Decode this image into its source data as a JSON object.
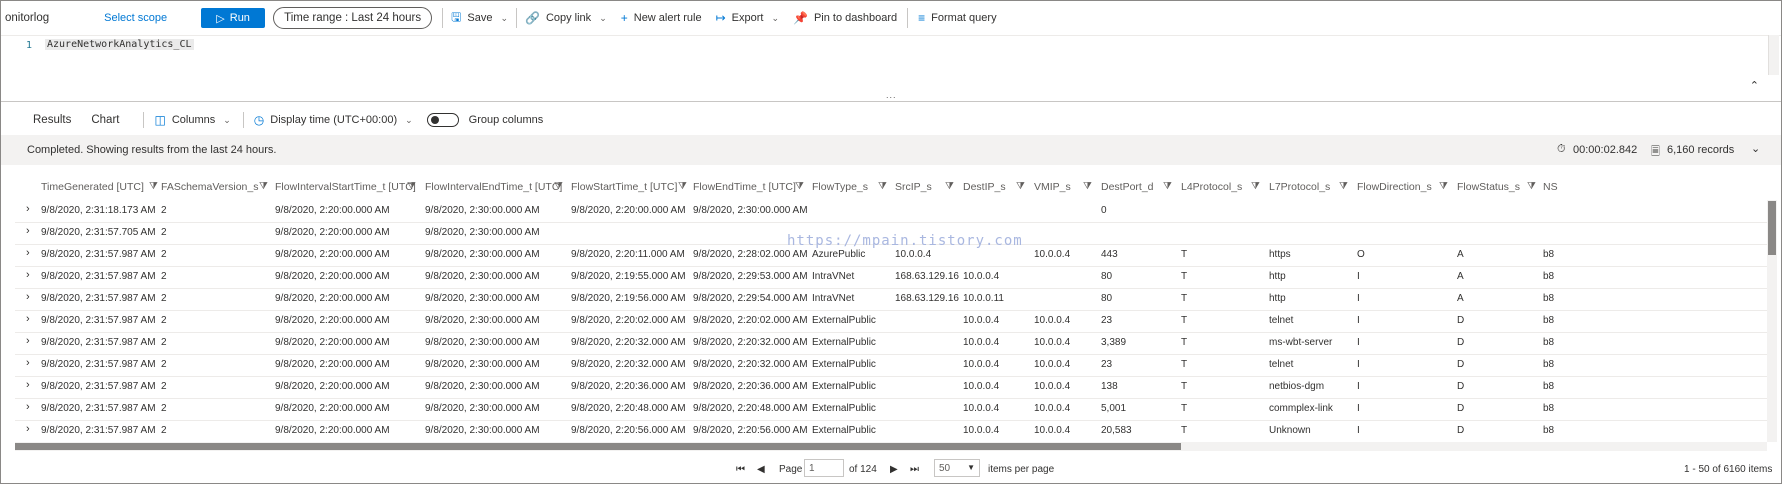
{
  "toolbar": {
    "scope_name": "onitorlog",
    "select_scope": "Select scope",
    "run": "Run",
    "time_range": "Time range :  Last 24 hours",
    "save": "Save",
    "copy_link": "Copy link",
    "new_alert": "New alert rule",
    "export": "Export",
    "pin": "Pin to dashboard",
    "format": "Format query"
  },
  "editor": {
    "line_number": "1",
    "query": "AzureNetworkAnalytics_CL",
    "grip": "..."
  },
  "results_tabs": {
    "results": "Results",
    "chart": "Chart",
    "columns": "Columns",
    "display_time": "Display time (UTC+00:00)",
    "group_columns": "Group columns"
  },
  "status": {
    "message": "Completed. Showing results from the last 24 hours.",
    "duration": "00:00:02.842",
    "records": "6,160 records"
  },
  "columns": [
    "TimeGenerated [UTC]",
    "FASchemaVersion_s",
    "FlowIntervalStartTime_t [UTC]",
    "FlowIntervalEndTime_t [UTC]",
    "FlowStartTime_t [UTC]",
    "FlowEndTime_t [UTC]",
    "FlowType_s",
    "SrcIP_s",
    "DestIP_s",
    "VMIP_s",
    "DestPort_d",
    "L4Protocol_s",
    "L7Protocol_s",
    "FlowDirection_s",
    "FlowStatus_s",
    "NS"
  ],
  "rows": [
    [
      "9/8/2020, 2:31:18.173 AM",
      "2",
      "9/8/2020, 2:20:00.000 AM",
      "9/8/2020, 2:30:00.000 AM",
      "9/8/2020, 2:20:00.000 AM",
      "9/8/2020, 2:30:00.000 AM",
      "",
      "",
      "",
      "",
      "0",
      "",
      "",
      "",
      "",
      ""
    ],
    [
      "9/8/2020, 2:31:57.705 AM",
      "2",
      "9/8/2020, 2:20:00.000 AM",
      "9/8/2020, 2:30:00.000 AM",
      "",
      "",
      "",
      "",
      "",
      "",
      "",
      "",
      "",
      "",
      "",
      ""
    ],
    [
      "9/8/2020, 2:31:57.987 AM",
      "2",
      "9/8/2020, 2:20:00.000 AM",
      "9/8/2020, 2:30:00.000 AM",
      "9/8/2020, 2:20:11.000 AM",
      "9/8/2020, 2:28:02.000 AM",
      "AzurePublic",
      "10.0.0.4",
      "",
      "10.0.0.4",
      "443",
      "T",
      "https",
      "O",
      "A",
      "b8"
    ],
    [
      "9/8/2020, 2:31:57.987 AM",
      "2",
      "9/8/2020, 2:20:00.000 AM",
      "9/8/2020, 2:30:00.000 AM",
      "9/8/2020, 2:19:55.000 AM",
      "9/8/2020, 2:29:53.000 AM",
      "IntraVNet",
      "168.63.129.16",
      "10.0.0.4",
      "",
      "80",
      "T",
      "http",
      "I",
      "A",
      "b8"
    ],
    [
      "9/8/2020, 2:31:57.987 AM",
      "2",
      "9/8/2020, 2:20:00.000 AM",
      "9/8/2020, 2:30:00.000 AM",
      "9/8/2020, 2:19:56.000 AM",
      "9/8/2020, 2:29:54.000 AM",
      "IntraVNet",
      "168.63.129.16",
      "10.0.0.11",
      "",
      "80",
      "T",
      "http",
      "I",
      "A",
      "b8"
    ],
    [
      "9/8/2020, 2:31:57.987 AM",
      "2",
      "9/8/2020, 2:20:00.000 AM",
      "9/8/2020, 2:30:00.000 AM",
      "9/8/2020, 2:20:02.000 AM",
      "9/8/2020, 2:20:02.000 AM",
      "ExternalPublic",
      "",
      "10.0.0.4",
      "10.0.0.4",
      "23",
      "T",
      "telnet",
      "I",
      "D",
      "b8"
    ],
    [
      "9/8/2020, 2:31:57.987 AM",
      "2",
      "9/8/2020, 2:20:00.000 AM",
      "9/8/2020, 2:30:00.000 AM",
      "9/8/2020, 2:20:32.000 AM",
      "9/8/2020, 2:20:32.000 AM",
      "ExternalPublic",
      "",
      "10.0.0.4",
      "10.0.0.4",
      "3,389",
      "T",
      "ms-wbt-server",
      "I",
      "D",
      "b8"
    ],
    [
      "9/8/2020, 2:31:57.987 AM",
      "2",
      "9/8/2020, 2:20:00.000 AM",
      "9/8/2020, 2:30:00.000 AM",
      "9/8/2020, 2:20:32.000 AM",
      "9/8/2020, 2:20:32.000 AM",
      "ExternalPublic",
      "",
      "10.0.0.4",
      "10.0.0.4",
      "23",
      "T",
      "telnet",
      "I",
      "D",
      "b8"
    ],
    [
      "9/8/2020, 2:31:57.987 AM",
      "2",
      "9/8/2020, 2:20:00.000 AM",
      "9/8/2020, 2:30:00.000 AM",
      "9/8/2020, 2:20:36.000 AM",
      "9/8/2020, 2:20:36.000 AM",
      "ExternalPublic",
      "",
      "10.0.0.4",
      "10.0.0.4",
      "138",
      "T",
      "netbios-dgm",
      "I",
      "D",
      "b8"
    ],
    [
      "9/8/2020, 2:31:57.987 AM",
      "2",
      "9/8/2020, 2:20:00.000 AM",
      "9/8/2020, 2:30:00.000 AM",
      "9/8/2020, 2:20:48.000 AM",
      "9/8/2020, 2:20:48.000 AM",
      "ExternalPublic",
      "",
      "10.0.0.4",
      "10.0.0.4",
      "5,001",
      "T",
      "commplex-link",
      "I",
      "D",
      "b8"
    ],
    [
      "9/8/2020, 2:31:57.987 AM",
      "2",
      "9/8/2020, 2:20:00.000 AM",
      "9/8/2020, 2:30:00.000 AM",
      "9/8/2020, 2:20:56.000 AM",
      "9/8/2020, 2:20:56.000 AM",
      "ExternalPublic",
      "",
      "10.0.0.4",
      "10.0.0.4",
      "20,583",
      "T",
      "Unknown",
      "I",
      "D",
      "b8"
    ]
  ],
  "watermark": "https://mpain.tistory.com",
  "pager": {
    "page_label": "Page",
    "page_value": "1",
    "of_pages": "of 124",
    "page_size": "50",
    "items_per_page": "items per page",
    "summary": "1 - 50 of 6160 items"
  },
  "colors": {
    "accent": "#0078d4"
  }
}
